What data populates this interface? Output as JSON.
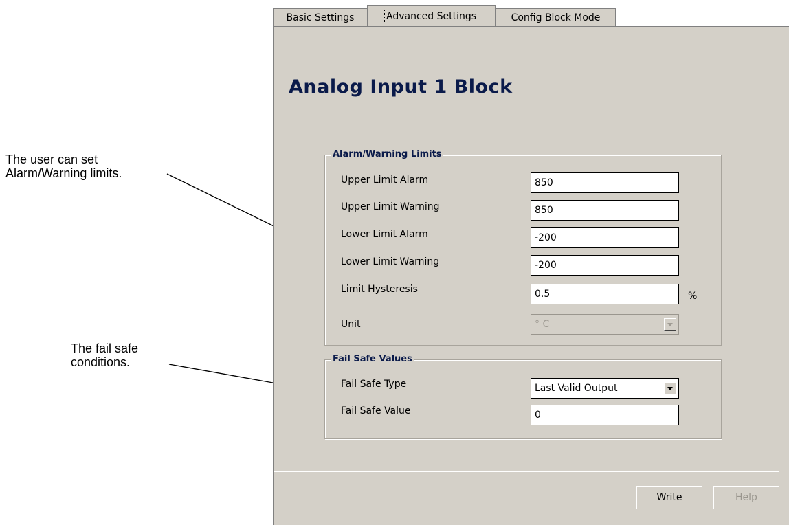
{
  "callouts": {
    "alarm_line1": "The user can set",
    "alarm_line2": "Alarm/Warning limits.",
    "failsafe_line1": "The fail safe",
    "failsafe_line2": "conditions."
  },
  "tabs": [
    {
      "label": "Basic Settings",
      "active": false
    },
    {
      "label": "Advanced Settings",
      "active": true
    },
    {
      "label": "Config Block Mode",
      "active": false
    }
  ],
  "page_title": "Analog Input 1 Block",
  "alarm_group": {
    "legend": "Alarm/Warning Limits",
    "rows": [
      {
        "label": "Upper Limit Alarm",
        "value": "850"
      },
      {
        "label": "Upper Limit Warning",
        "value": "850"
      },
      {
        "label": "Lower Limit Alarm",
        "value": "-200"
      },
      {
        "label": "Lower Limit Warning",
        "value": "-200"
      },
      {
        "label": "Limit Hysteresis",
        "value": "0.5",
        "unit": "%"
      }
    ],
    "unit_row": {
      "label": "Unit",
      "value": "° C",
      "disabled": true
    }
  },
  "failsafe_group": {
    "legend": "Fail Safe Values",
    "type_label": "Fail Safe Type",
    "type_value": "Last Valid Output",
    "value_label": "Fail Safe Value",
    "value": "0"
  },
  "buttons": {
    "write": "Write",
    "help": "Help"
  }
}
